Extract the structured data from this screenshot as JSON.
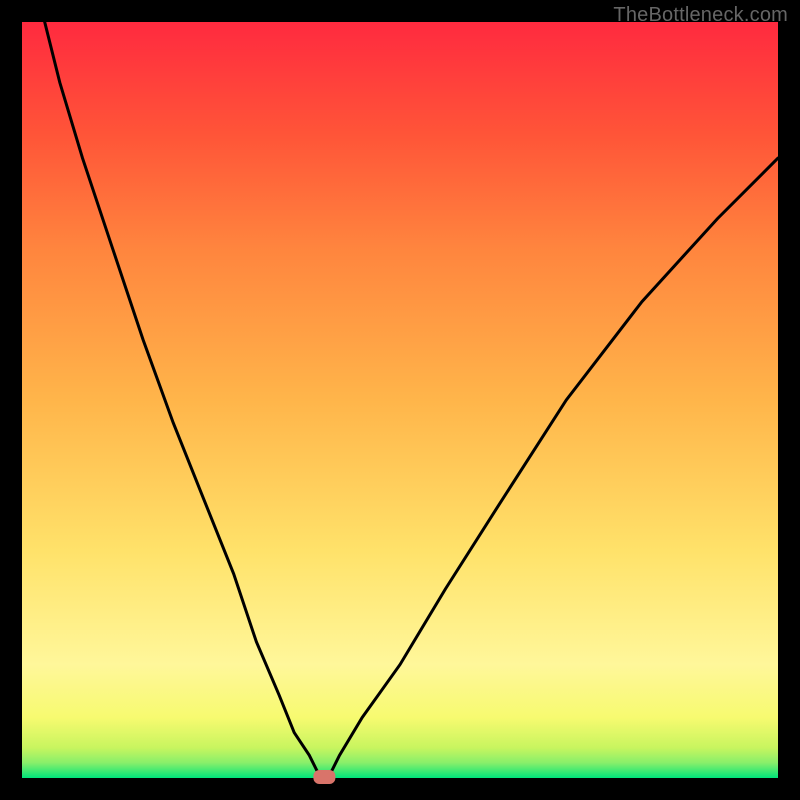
{
  "watermark": "TheBottleneck.com",
  "chart_data": {
    "type": "line",
    "title": "",
    "xlabel": "",
    "ylabel": "",
    "xlim": [
      0,
      100
    ],
    "ylim": [
      0,
      100
    ],
    "grid": false,
    "background": "rainbow-gradient-red-to-green",
    "series": [
      {
        "name": "bottleneck-curve",
        "x": [
          3,
          5,
          8,
          12,
          16,
          20,
          24,
          28,
          31,
          34,
          36,
          38,
          39,
          40,
          41,
          42,
          45,
          50,
          56,
          63,
          72,
          82,
          92,
          100
        ],
        "y": [
          100,
          92,
          82,
          70,
          58,
          47,
          37,
          27,
          18,
          11,
          6,
          3,
          1,
          0,
          1,
          3,
          8,
          15,
          25,
          36,
          50,
          63,
          74,
          82
        ]
      }
    ],
    "marker": {
      "name": "optimal-point",
      "x": 40,
      "y": 0,
      "color": "#d9746a"
    },
    "gradient_stops": [
      {
        "offset": 0,
        "color": "#00e47a"
      },
      {
        "offset": 2,
        "color": "#88ef6a"
      },
      {
        "offset": 4,
        "color": "#c8f55f"
      },
      {
        "offset": 8,
        "color": "#f7fa70"
      },
      {
        "offset": 15,
        "color": "#fff79a"
      },
      {
        "offset": 30,
        "color": "#ffe26a"
      },
      {
        "offset": 50,
        "color": "#ffb54a"
      },
      {
        "offset": 70,
        "color": "#ff853e"
      },
      {
        "offset": 85,
        "color": "#ff5538"
      },
      {
        "offset": 100,
        "color": "#ff2a3f"
      }
    ]
  }
}
